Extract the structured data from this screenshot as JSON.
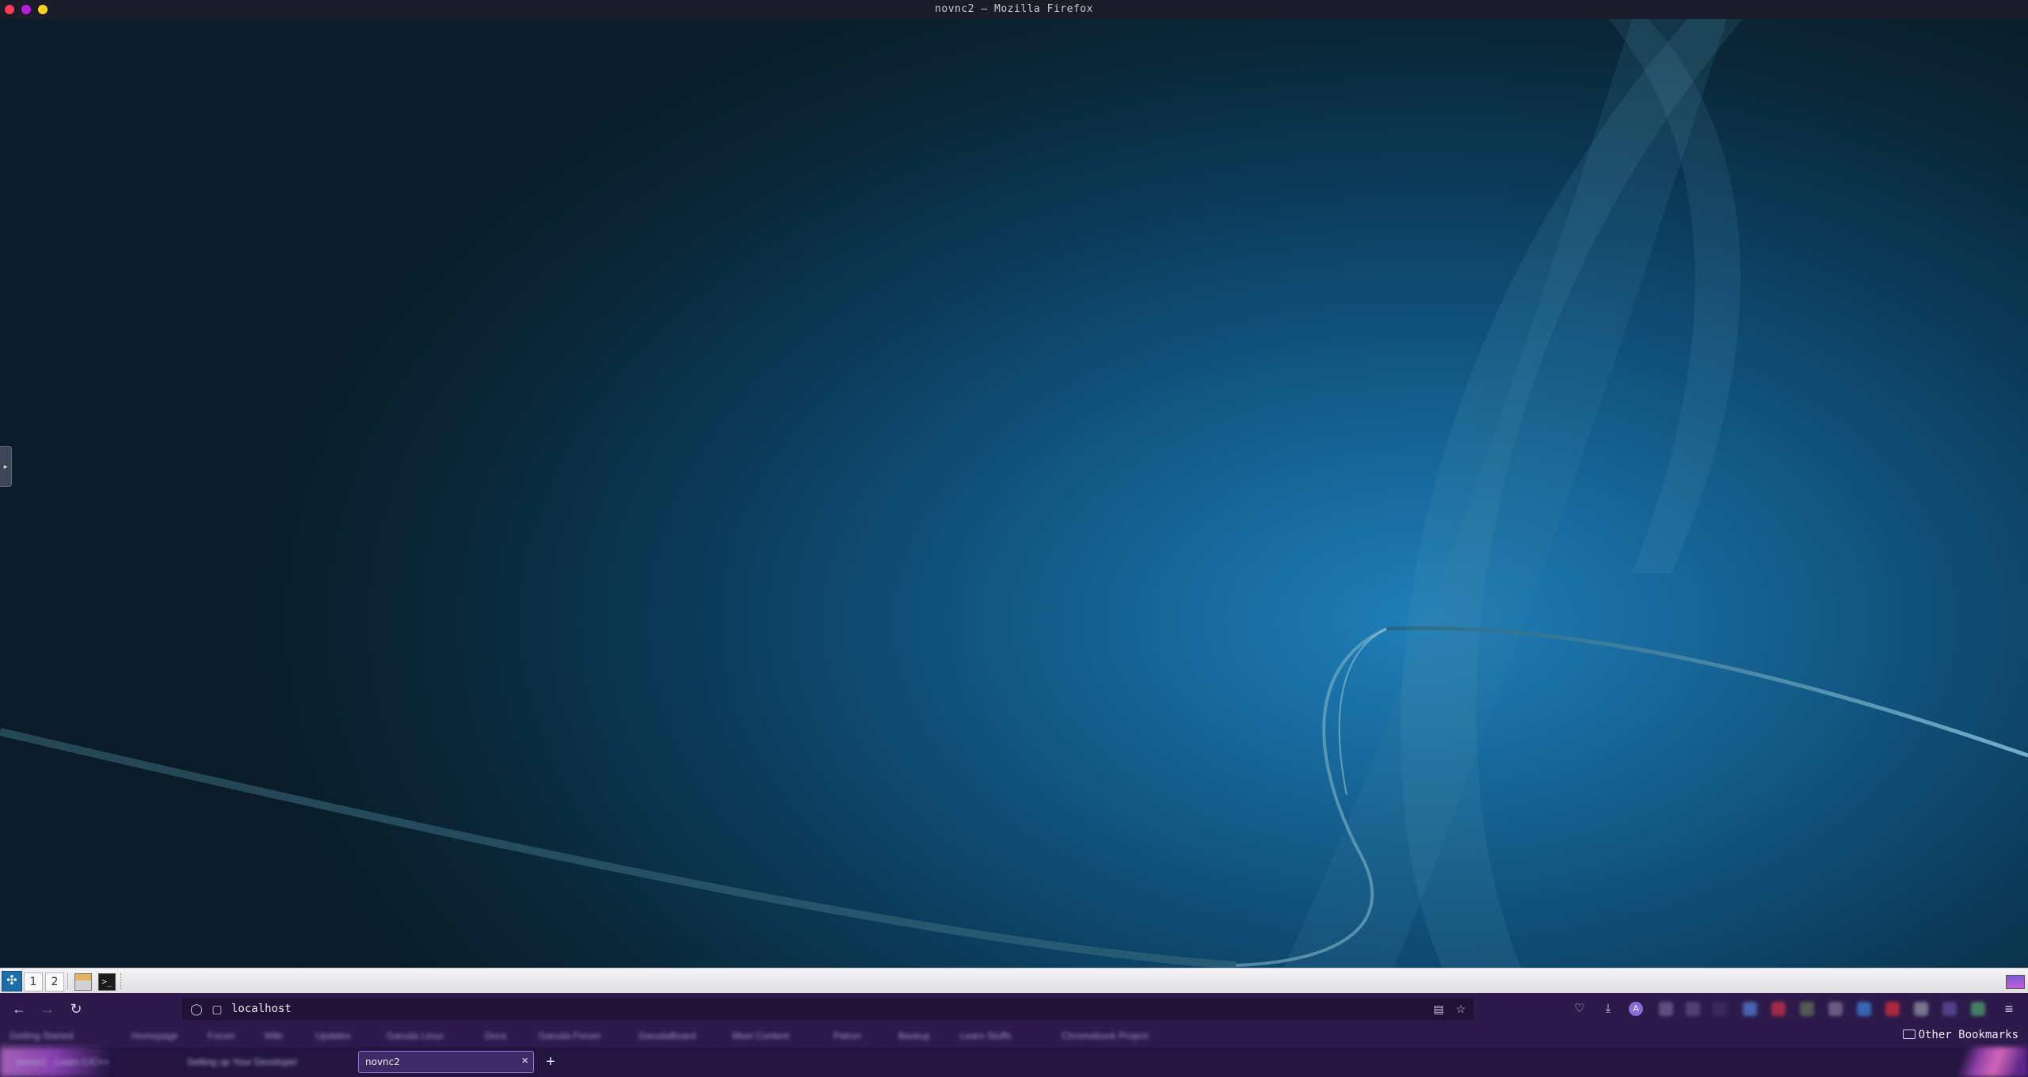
{
  "window": {
    "title": "novnc2 — Mozilla Firefox",
    "controls": [
      {
        "name": "close",
        "color": "#ff3b52"
      },
      {
        "name": "minimize",
        "color": "#b51fd6"
      },
      {
        "name": "maximize",
        "color": "#ffd21a"
      }
    ]
  },
  "remote_desktop": {
    "side_handle_glyph": "▸",
    "accent_color": "#1f7fb8"
  },
  "panel": {
    "start_icon": "linux-menu-icon",
    "workspaces": [
      "1",
      "2"
    ],
    "apps": [
      "file-manager-icon",
      "terminal-icon"
    ],
    "tray_icon": "tray-app-icon"
  },
  "firefox": {
    "nav": {
      "back": "←",
      "forward": "→",
      "reload": "↻"
    },
    "url": "localhost",
    "urlbar_icons": {
      "shield": "◯",
      "page": "▢",
      "reader": "▤",
      "bookmark": "☆"
    },
    "toolbar_icons": {
      "pocket": "♡",
      "downloads": "⤓",
      "account": "A",
      "menu": "≡"
    },
    "bookmarks": [
      "Getting Started",
      "Homepage",
      "Forum",
      "Wiki",
      "Updates",
      "Garuda Linux",
      "Docs",
      "Garuda Forum",
      "GarudaBoard",
      "Meet Content",
      "Patron",
      "Backup",
      "Learn Stuffs",
      "Chromebook Project"
    ],
    "other_bookmarks": "Other Bookmarks",
    "tabs": [
      {
        "label": "novnc2 · Learn C/C++",
        "active": false
      },
      {
        "label": "Setting up Your Developer",
        "active": false
      },
      {
        "label": "novnc2",
        "active": true
      }
    ],
    "close_tab": "×",
    "new_tab": "+"
  }
}
